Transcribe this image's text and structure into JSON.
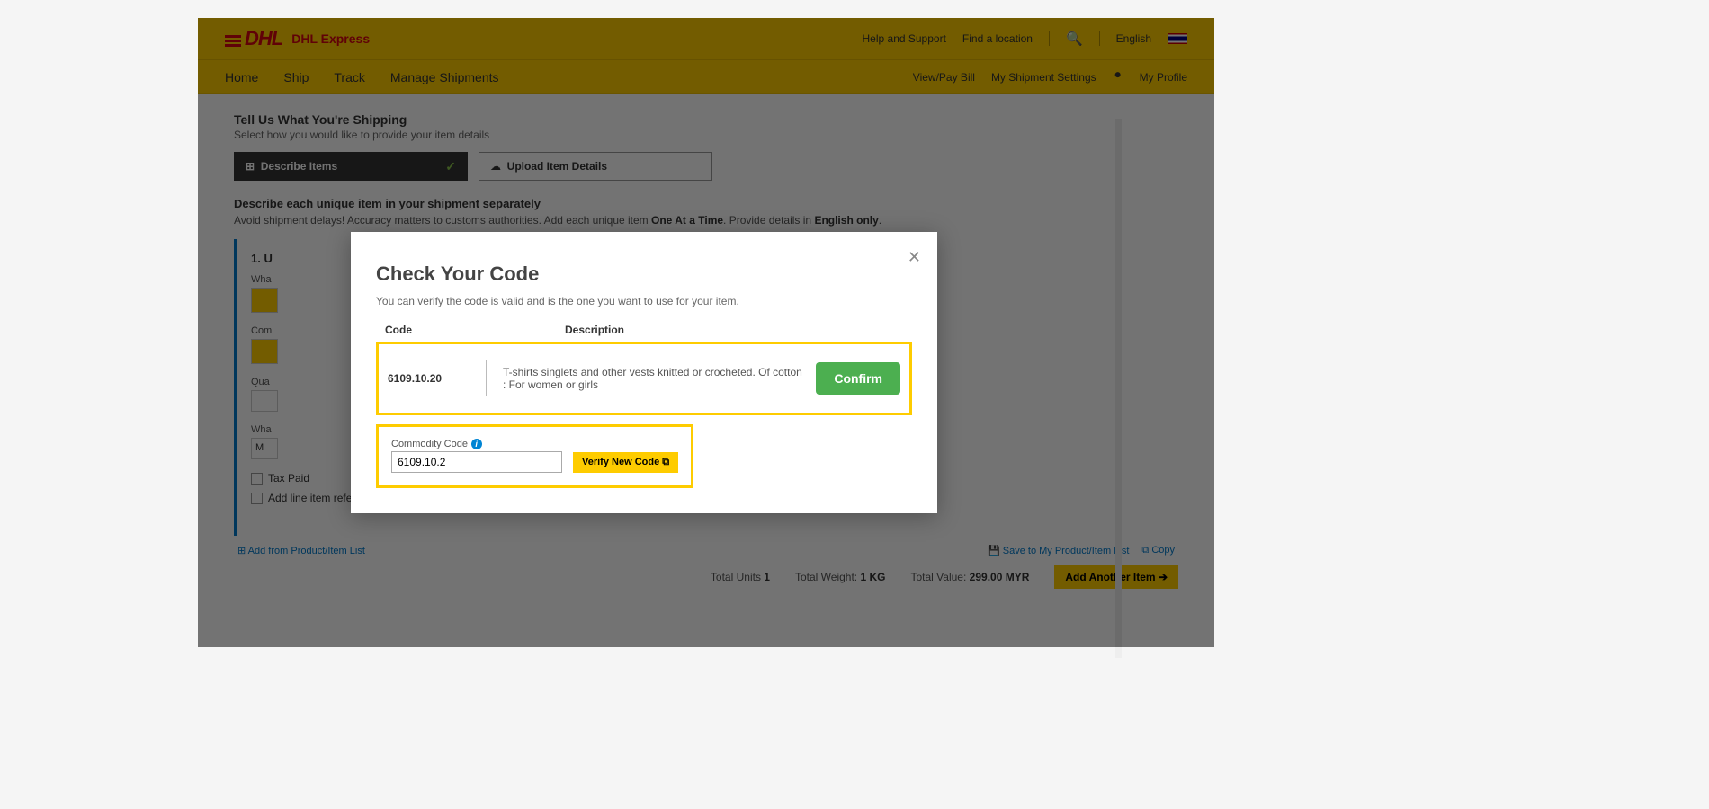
{
  "header": {
    "logo_text": "DHL",
    "brand_sub": "DHL Express",
    "help_support": "Help and Support",
    "find_location": "Find a location",
    "language": "English"
  },
  "nav": {
    "home": "Home",
    "ship": "Ship",
    "track": "Track",
    "manage": "Manage Shipments",
    "view_pay": "View/Pay Bill",
    "settings": "My Shipment Settings",
    "profile": "My Profile"
  },
  "main": {
    "title": "Tell Us What You're Shipping",
    "subtitle": "Select how you would like to provide your item details",
    "toggle_describe": "Describe Items",
    "toggle_upload": "Upload Item Details",
    "describe_heading": "Describe each unique item in your shipment separately",
    "describe_sub_a": "Avoid shipment delays! Accuracy matters to customs authorities.  Add each unique item ",
    "describe_sub_b": "One At a Time",
    "describe_sub_c": ".  Provide details in ",
    "describe_sub_d": "English only",
    "describe_sub_e": "."
  },
  "item": {
    "heading": "1. U",
    "what_label": "Wha",
    "commodity_label": "Com",
    "qty_label": "Qua",
    "what2_label": "Wha",
    "m": "M",
    "tax_paid": "Tax Paid",
    "add_ref": "Add line item reference"
  },
  "footer_links": {
    "add_from": "Add from Product/Item List",
    "save_to": "Save to My Product/Item List",
    "copy": "Copy"
  },
  "totals": {
    "units_label": "Total Units",
    "units_value": "1",
    "weight_label": "Total Weight:",
    "weight_value": "1 KG",
    "value_label": "Total Value:",
    "value_value": "299.00 MYR",
    "add_another": "Add Another Item"
  },
  "modal": {
    "title": "Check Your Code",
    "subtitle": "You can verify the code is valid and is the one you want to use for your item.",
    "col_code": "Code",
    "col_desc": "Description",
    "result_code": "6109.10.20",
    "result_desc": "T-shirts singlets and other vests knitted or crocheted. Of cotton : For women or girls",
    "confirm": "Confirm",
    "commodity_label": "Commodity Code",
    "input_value": "6109.10.2",
    "verify_btn": "Verify New Code"
  }
}
